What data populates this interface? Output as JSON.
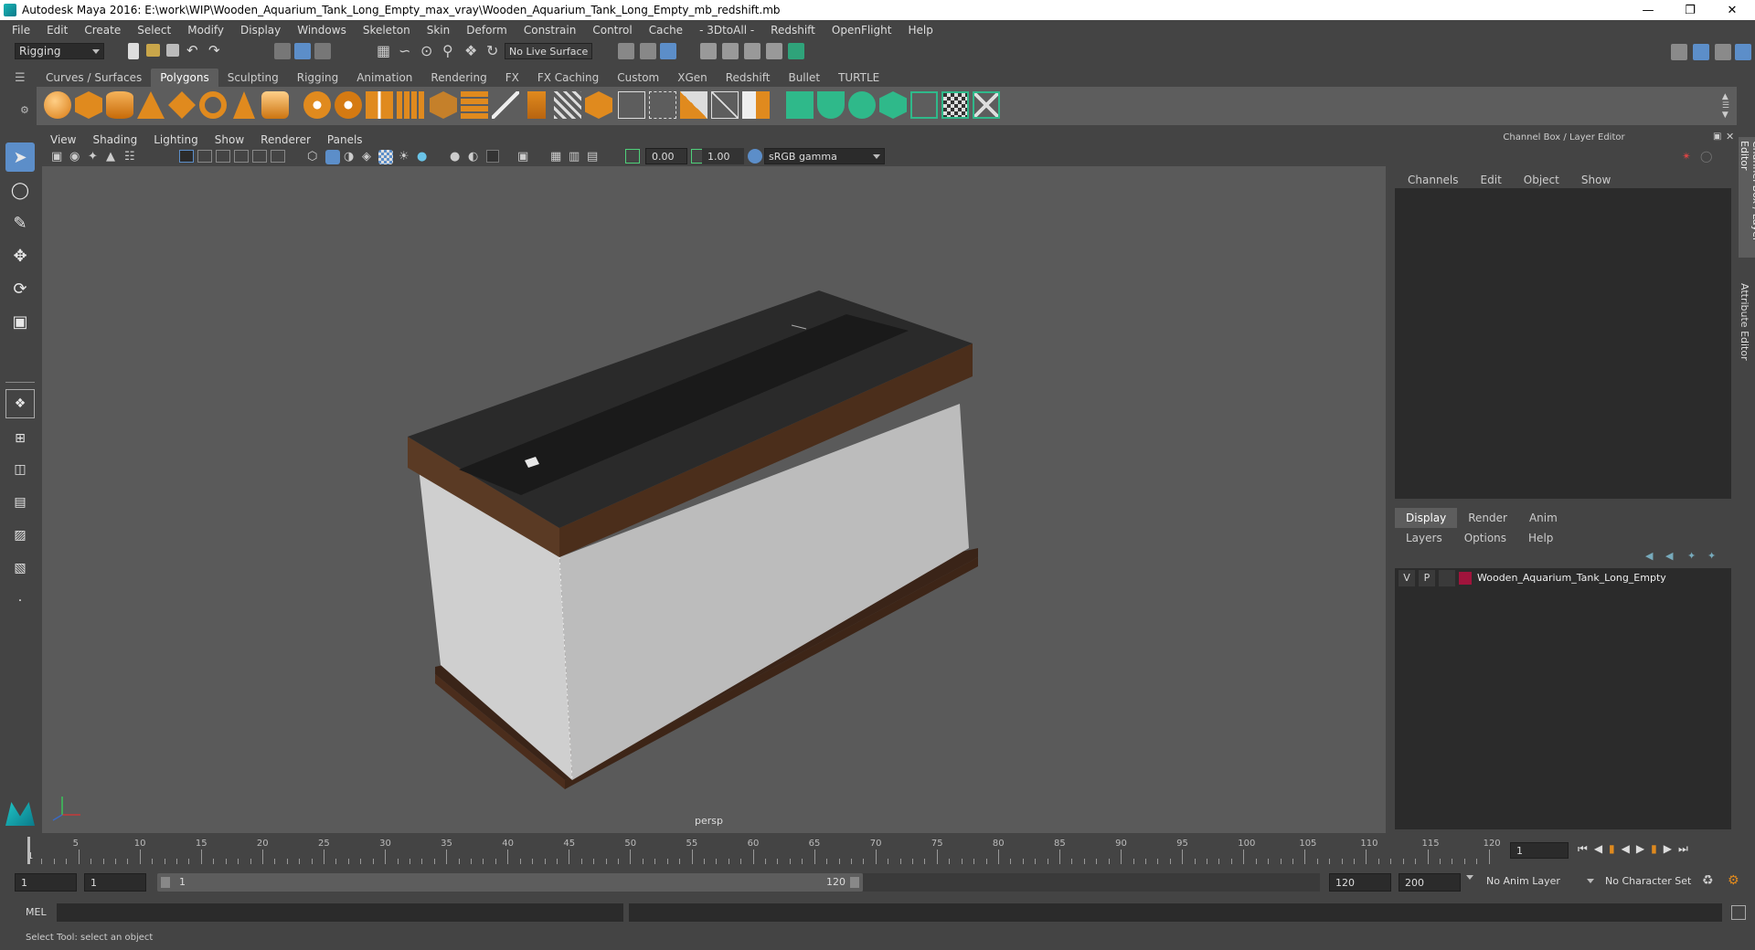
{
  "window": {
    "title": "Autodesk Maya 2016: E:\\work\\WIP\\Wooden_Aquarium_Tank_Long_Empty_max_vray\\Wooden_Aquarium_Tank_Long_Empty_mb_redshift.mb"
  },
  "menubar": [
    "File",
    "Edit",
    "Create",
    "Select",
    "Modify",
    "Display",
    "Windows",
    "Skeleton",
    "Skin",
    "Deform",
    "Constrain",
    "Control",
    "Cache",
    "- 3DtoAll -",
    "Redshift",
    "OpenFlight",
    "Help"
  ],
  "statusline": {
    "menuset": "Rigging",
    "live_surface": "No Live Surface"
  },
  "shelf": {
    "tabs": [
      "Curves / Surfaces",
      "Polygons",
      "Sculpting",
      "Rigging",
      "Animation",
      "Rendering",
      "FX",
      "FX Caching",
      "Custom",
      "XGen",
      "Redshift",
      "Bullet",
      "TURTLE"
    ],
    "active_tab": "Polygons"
  },
  "viewport": {
    "menu": [
      "View",
      "Shading",
      "Lighting",
      "Show",
      "Renderer",
      "Panels"
    ],
    "exposure": "0.00",
    "gamma": "1.00",
    "color_space": "sRGB gamma",
    "camera_label": "persp"
  },
  "channel_box": {
    "title": "Channel Box / Layer Editor",
    "menu": [
      "Channels",
      "Edit",
      "Object",
      "Show"
    ]
  },
  "layer_editor": {
    "tabs": [
      "Display",
      "Render",
      "Anim"
    ],
    "active_tab": "Display",
    "menu": [
      "Layers",
      "Options",
      "Help"
    ],
    "layers": [
      {
        "visible": "V",
        "playback": "P",
        "name": "Wooden_Aquarium_Tank_Long_Empty",
        "color": "#a0143c"
      }
    ]
  },
  "side_tabs": [
    "Channel Box / Layer Editor",
    "Attribute Editor"
  ],
  "timeslider": {
    "ticks": [
      "5",
      "10",
      "15",
      "20",
      "25",
      "30",
      "35",
      "40",
      "45",
      "50",
      "55",
      "60",
      "65",
      "70",
      "75",
      "80",
      "85",
      "90",
      "95",
      "100",
      "105",
      "110",
      "115",
      "120"
    ],
    "first_frame": "1",
    "current_frame": "1"
  },
  "rangeslider": {
    "start": "1",
    "playback_start": "1",
    "range_start": "1",
    "range_end": "120",
    "playback_end": "120",
    "end": "200",
    "anim_layer": "No Anim Layer",
    "character_set": "No Character Set"
  },
  "commandline": {
    "label": "MEL"
  },
  "helpline": {
    "text": "Select Tool: select an object"
  }
}
